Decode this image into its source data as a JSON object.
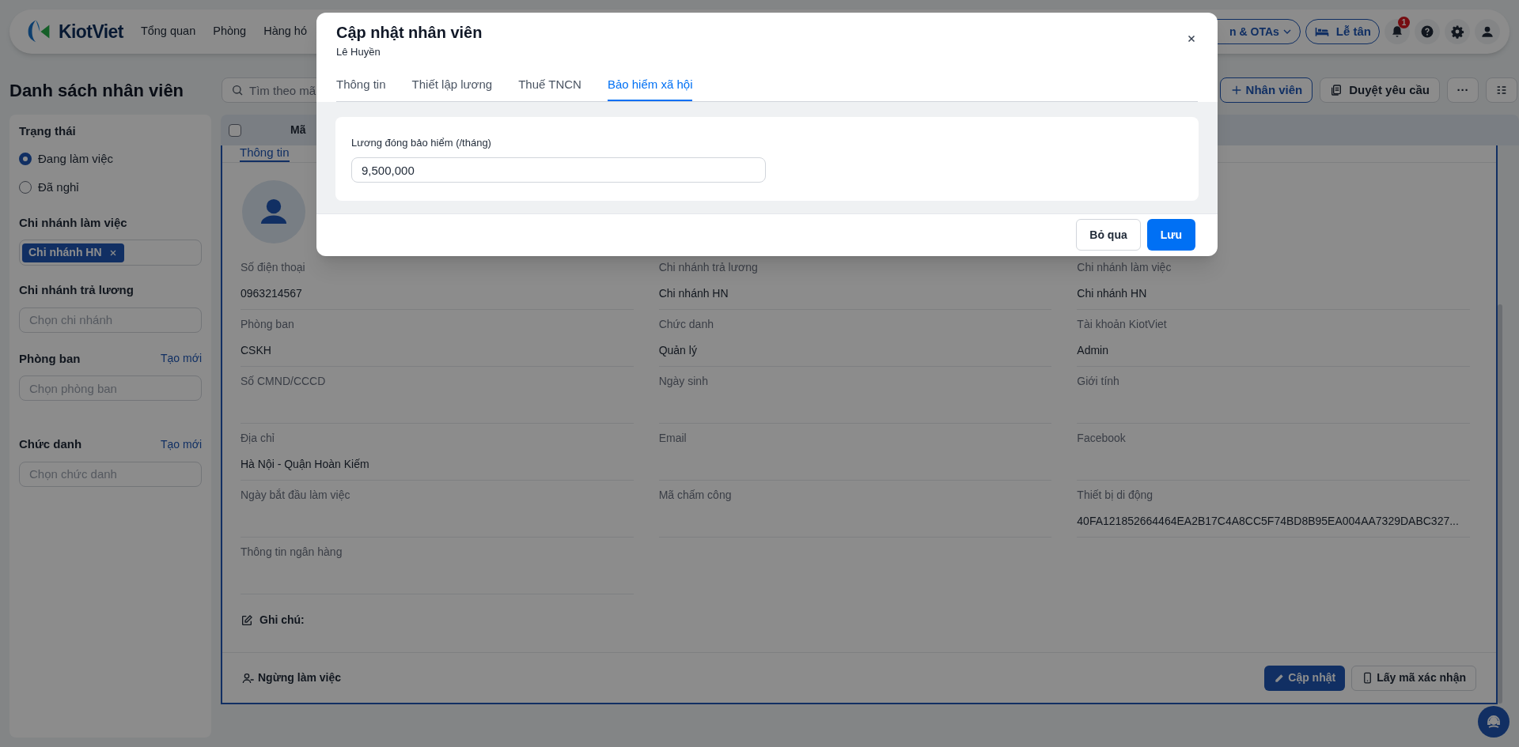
{
  "header": {
    "logo": "KiotViet",
    "nav": [
      {
        "label": "Tổng quan"
      },
      {
        "label": "Phòng"
      },
      {
        "label": "Hàng hó"
      }
    ],
    "channel_button": "n & OTAs",
    "reception_button": "Lễ tân",
    "notification_count": "1"
  },
  "toolbar": {
    "title": "Danh sách nhân viên",
    "search_placeholder": "Tìm theo mã",
    "actions": [
      {
        "kind": "add",
        "label": "Nhân viên"
      },
      {
        "kind": "approve",
        "label": "Duyệt yêu cầu"
      },
      {
        "kind": "more",
        "label": "···"
      },
      {
        "kind": "columns"
      }
    ]
  },
  "filters": {
    "status": {
      "title": "Trạng thái",
      "options": [
        {
          "label": "Đang làm việc",
          "selected": true
        },
        {
          "label": "Đã nghỉ",
          "selected": false
        }
      ]
    },
    "work_branch": {
      "title": "Chi nhánh làm việc",
      "tags": [
        "Chi nhánh HN"
      ]
    },
    "pay_branch": {
      "title": "Chi nhánh trả lương",
      "placeholder": "Chọn chi nhánh"
    },
    "department": {
      "title": "Phòng ban",
      "link": "Tạo mới",
      "placeholder": "Chọn phòng ban"
    },
    "job_title": {
      "title": "Chức danh",
      "link": "Tạo mới",
      "placeholder": "Chọn chức danh"
    }
  },
  "table": {
    "select_all": {
      "checked": false
    },
    "columns": [
      "Mã"
    ]
  },
  "detail": {
    "tabs": [
      {
        "label": "Thông tin",
        "selected": true
      }
    ],
    "fields": [
      {
        "label": "Số điện thoại",
        "value": "0963214567"
      },
      {
        "label": "Chi nhánh trả lương",
        "value": "Chi nhánh HN"
      },
      {
        "label": "Chi nhánh làm việc",
        "value": "Chi nhánh HN"
      },
      {
        "label": "Phòng ban",
        "value": "CSKH"
      },
      {
        "label": "Chức danh",
        "value": "Quản lý"
      },
      {
        "label": "Tài khoản KiotViet",
        "value": "Admin"
      },
      {
        "label": "Số CMND/CCCD"
      },
      {
        "label": "Ngày sinh"
      },
      {
        "label": "Giới tính"
      },
      {
        "label": "Địa chỉ",
        "value": "Hà Nội - Quận Hoàn Kiếm"
      },
      {
        "label": "Email"
      },
      {
        "label": "Facebook"
      },
      {
        "label": "Ngày bắt đầu làm việc"
      },
      {
        "label": "Mã chấm công"
      },
      {
        "label": "Thiết bị di động",
        "value": "40FA121852664464EA2B17C4A8CC5F74BD8B95EA004AA7329DABC327..."
      },
      {
        "label": "Thông tin ngân hàng"
      }
    ],
    "note_label": "Ghi chú:",
    "stop_button": "Ngừng làm việc",
    "update_button": "Cập nhật",
    "code_button": "Lấy mã xác nhận"
  },
  "modal": {
    "title": "Cập nhật nhân viên",
    "subtitle": "Lê Huyền",
    "tabs": [
      {
        "label": "Thông tin",
        "selected": false
      },
      {
        "label": "Thiết lập lương",
        "selected": false
      },
      {
        "label": "Thuế TNCN",
        "selected": false
      },
      {
        "label": "Bảo hiểm xã hội",
        "selected": true
      }
    ],
    "field_label": "Lương đóng bảo hiểm (/tháng)",
    "field_value": "9,500,000",
    "buttons": [
      {
        "kind": "secondary",
        "label": "Bỏ qua"
      },
      {
        "kind": "primary",
        "label": "Lưu"
      }
    ]
  }
}
